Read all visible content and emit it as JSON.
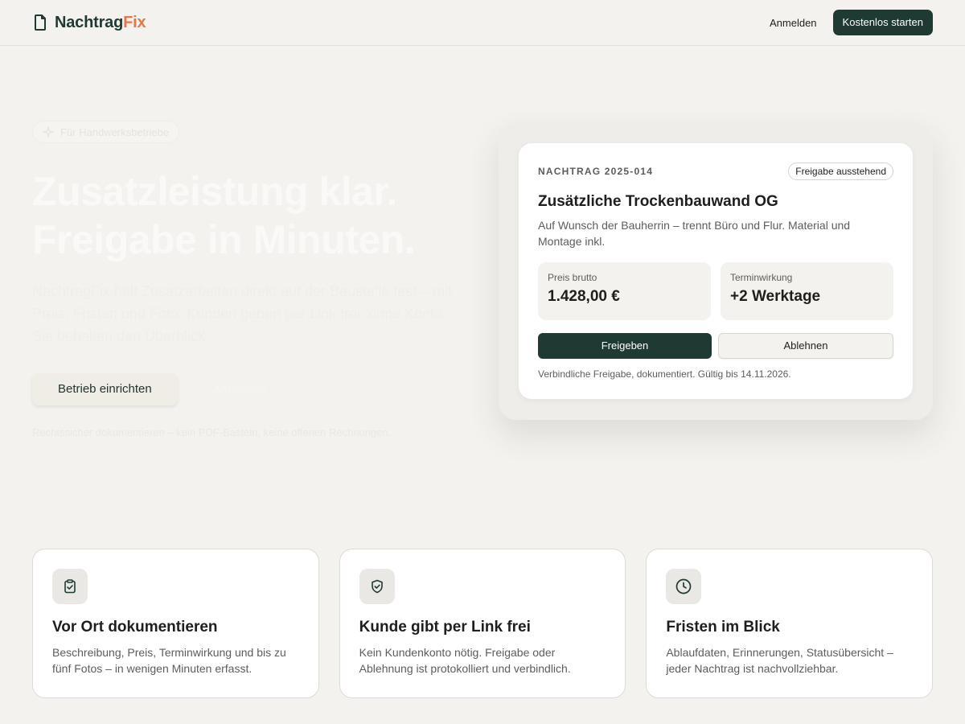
{
  "header": {
    "logo_part1": "Nachtrag",
    "logo_part2": "Fix",
    "logo_icon": "document-icon",
    "login_label": "Anmelden",
    "cta_label": "Kostenlos starten"
  },
  "hero": {
    "badge_icon": "sparkle-icon",
    "badge_label": "Für Handwerksbetriebe",
    "headline_line1": "Zusatzleistung klar.",
    "headline_line2": "Freigabe in Minuten.",
    "subcopy": "NachtragFix hält Zusatzarbeiten direkt auf der Baustelle fest – mit Preis, Fristen und Foto. Kunden geben per Link frei, ohne Konto. Sie behalten den Überblick.",
    "primary_cta": "Betrieb einrichten",
    "secondary_cta": "Anmelden",
    "fineprint": "Rechtssicher dokumentieren – kein PDF-Basteln, keine offenen Rechnungen."
  },
  "card": {
    "id_label": "NACHTRAG 2025-014",
    "status": "Freigabe ausstehend",
    "title": "Zusätzliche Trockenbauwand OG",
    "description": "Auf Wunsch der Bauherrin – trennt Büro und Flur. Material und Montage inkl.",
    "price_label": "Preis brutto",
    "price_value": "1.428,00 €",
    "schedule_label": "Terminwirkung",
    "schedule_value": "+2 Werktage",
    "approve_label": "Freigeben",
    "reject_label": "Ablehnen",
    "note": "Verbindliche Freigabe, dokumentiert. Gültig bis 14.11.2026."
  },
  "features": [
    {
      "icon": "clipboard-check-icon",
      "title": "Vor Ort dokumentieren",
      "description": "Beschreibung, Preis, Terminwirkung und bis zu fünf Fotos – in wenigen Minuten erfasst."
    },
    {
      "icon": "shield-check-icon",
      "title": "Kunde gibt per Link frei",
      "description": "Kein Kundenkonto nötig. Freigabe oder Ablehnung ist protokolliert und verbindlich."
    },
    {
      "icon": "clock-icon",
      "title": "Fristen im Blick",
      "description": "Ablaufdaten, Erinnerungen, Statusübersicht – jeder Nachtrag ist nachvollziehbar."
    }
  ],
  "colors": {
    "brand_dark": "#1f3a32",
    "brand_accent": "#e3774a",
    "background": "#f4f2ee"
  }
}
